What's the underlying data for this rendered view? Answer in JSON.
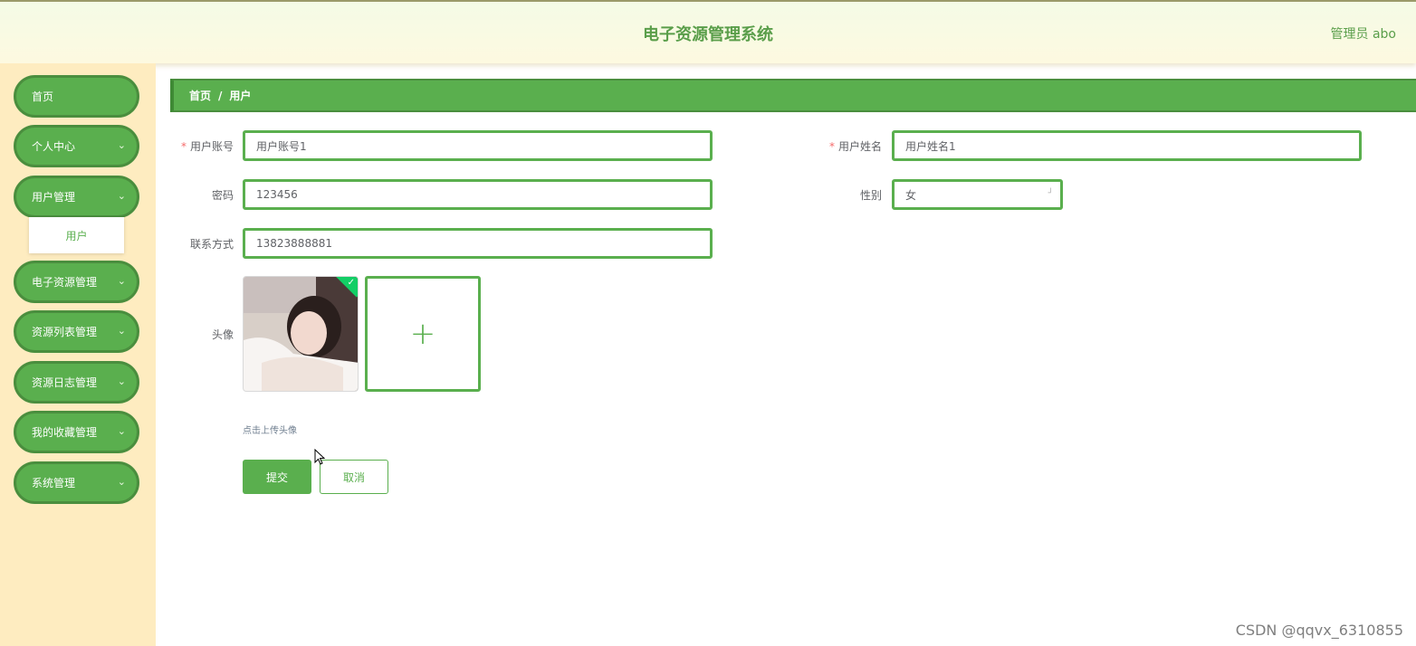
{
  "header": {
    "title": "电子资源管理系统",
    "user": "管理员 abo"
  },
  "sidebar": {
    "items": [
      {
        "label": "首页",
        "has_children": false
      },
      {
        "label": "个人中心",
        "has_children": true
      },
      {
        "label": "用户管理",
        "has_children": true
      },
      {
        "label": "电子资源管理",
        "has_children": true
      },
      {
        "label": "资源列表管理",
        "has_children": true
      },
      {
        "label": "资源日志管理",
        "has_children": true
      },
      {
        "label": "我的收藏管理",
        "has_children": true
      },
      {
        "label": "系统管理",
        "has_children": true
      }
    ],
    "submenu": {
      "label": "用户"
    },
    "chevron": "⌄"
  },
  "breadcrumb": {
    "home": "首页",
    "separator": "/",
    "current": "用户"
  },
  "form": {
    "account": {
      "label": "用户账号",
      "value": "用户账号1",
      "required": true
    },
    "name": {
      "label": "用户姓名",
      "value": "用户姓名1",
      "required": true
    },
    "password": {
      "label": "密码",
      "value": "123456"
    },
    "gender": {
      "label": "性别",
      "value": "女"
    },
    "phone": {
      "label": "联系方式",
      "value": "13823888881"
    },
    "avatar": {
      "label": "头像",
      "tip": "点击上传头像",
      "add_symbol": "+"
    },
    "required_mark": "*"
  },
  "buttons": {
    "submit": "提交",
    "cancel": "取消"
  },
  "watermark": "CSDN @qqvx_6310855",
  "colors": {
    "accent": "#5aaf4e",
    "sidebar_bg": "#feecc0",
    "required": "#f56c6c"
  }
}
